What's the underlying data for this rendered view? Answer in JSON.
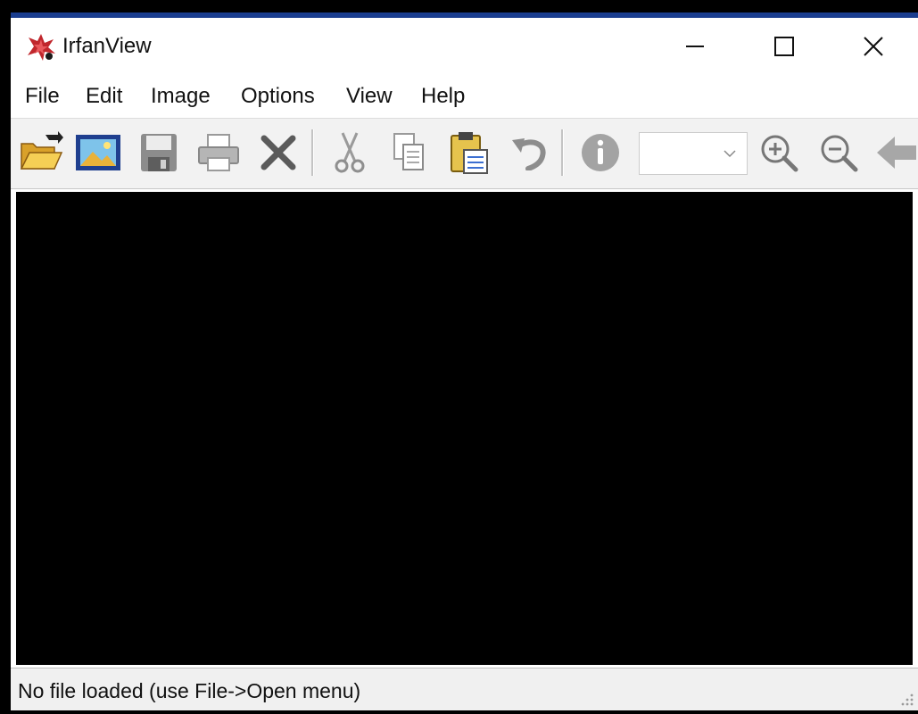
{
  "window": {
    "title": "IrfanView"
  },
  "menu": {
    "file": "File",
    "edit": "Edit",
    "image": "Image",
    "options": "Options",
    "view": "View",
    "help": "Help"
  },
  "toolbar": {
    "icons": [
      "open-folder-icon",
      "slideshow-icon",
      "save-icon",
      "print-icon",
      "delete-icon",
      "cut-icon",
      "copy-icon",
      "paste-icon",
      "undo-icon",
      "info-icon",
      "zoom-in-icon",
      "zoom-out-icon",
      "previous-arrow-icon"
    ],
    "zoom_value": ""
  },
  "status": {
    "text": "No file loaded (use File->Open menu)"
  },
  "colors": {
    "titlebar_accent": "#1a3d8f",
    "canvas": "#000000",
    "toolbar_bg": "#f2f2f2",
    "statusbar_bg": "#f0f0f0"
  }
}
